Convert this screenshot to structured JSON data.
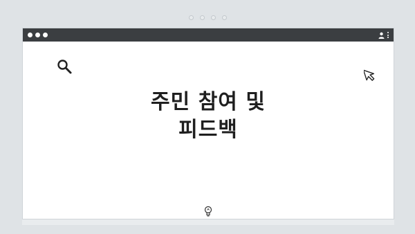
{
  "window": {
    "traffic_lights": [
      "dot",
      "dot",
      "dot"
    ],
    "title_icons": [
      "user-icon",
      "kebab-menu-icon"
    ]
  },
  "headline": {
    "line1": "주민 참여 및",
    "line2": "피드백"
  },
  "icons": {
    "top_left": "search-icon",
    "top_right": "cursor-arrow-icon",
    "bottom": "lightbulb-icon"
  },
  "colors": {
    "page_background": "#dfe3e6",
    "titlebar": "#3b3e41",
    "window_background": "#ffffff",
    "headline_text": "#1f1f1f"
  }
}
